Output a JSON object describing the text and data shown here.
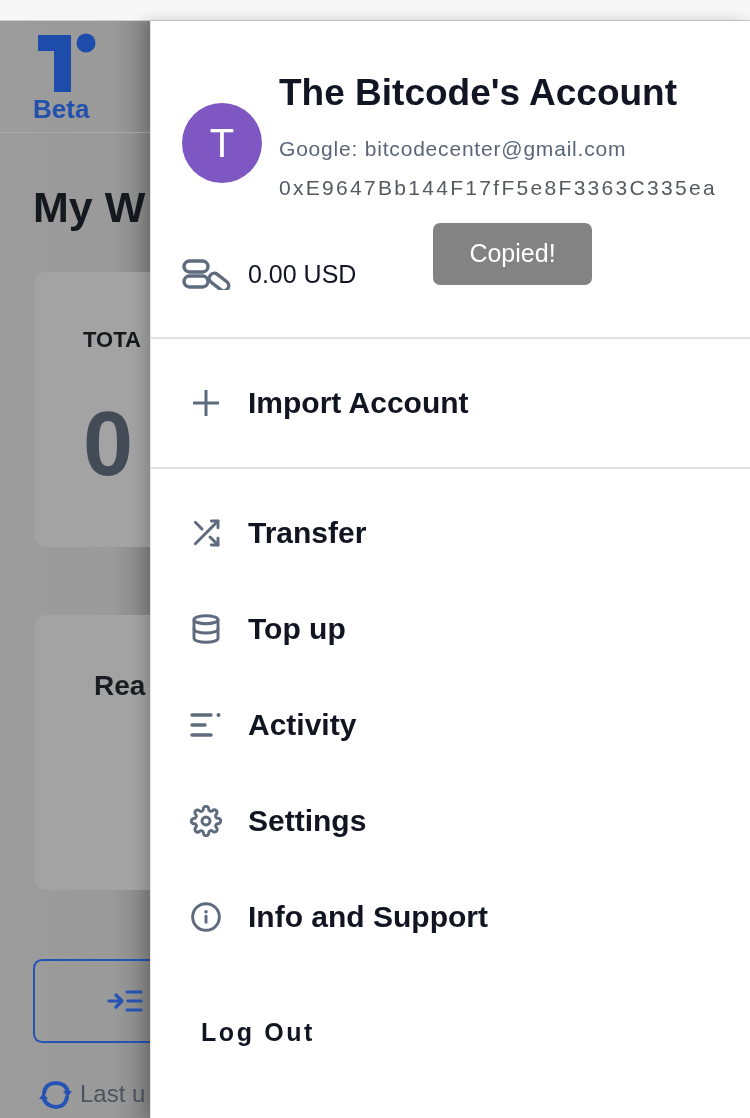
{
  "page": {
    "logo_text": "Beta",
    "heading": "My W",
    "total_card": {
      "label": "TOTA",
      "amount": "0"
    },
    "second_card": {
      "title": "Rea"
    },
    "status": "Last u"
  },
  "drawer": {
    "account": {
      "avatar_letter": "T",
      "name": "The Bitcode's Account",
      "login": "Google: bitcodecenter@gmail.com",
      "address": "0xE9647Bb144F17fF5e8F3363C335ea",
      "tooltip": "Copied!",
      "balance": "0.00 USD"
    },
    "menu_sections": [
      {
        "items": [
          {
            "label": "Import Account"
          }
        ]
      },
      {
        "items": [
          {
            "label": "Transfer"
          },
          {
            "label": "Top up"
          },
          {
            "label": "Activity"
          },
          {
            "label": "Settings"
          },
          {
            "label": "Info and Support"
          }
        ]
      }
    ],
    "logout": "Log Out"
  }
}
